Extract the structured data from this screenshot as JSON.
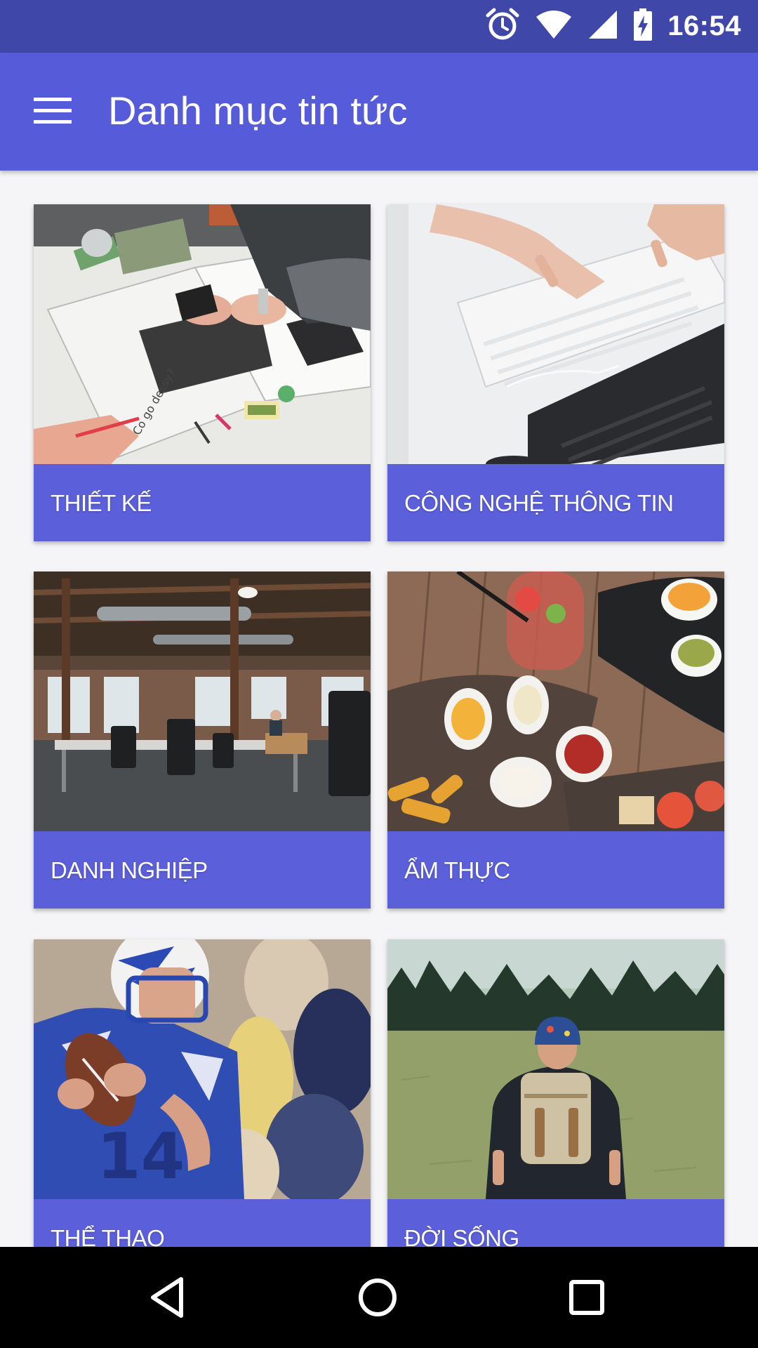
{
  "status_bar": {
    "time": "16:54",
    "icons": [
      "alarm-icon",
      "wifi-icon",
      "signal-icon",
      "battery-charging-icon"
    ],
    "background": "#3f48a8"
  },
  "app_bar": {
    "title": "Danh mục tin tức",
    "menu_icon": "hamburger-menu-icon",
    "background": "#565bda"
  },
  "categories": [
    {
      "label": "THIẾT KẾ",
      "image": "design-desk-photo"
    },
    {
      "label": "CÔNG NGHỆ THÔNG TIN",
      "image": "keyboard-typing-photo"
    },
    {
      "label": "DANH NGHIỆP",
      "image": "office-interior-photo"
    },
    {
      "label": "ẨM THỰC",
      "image": "food-table-photo"
    },
    {
      "label": "THỂ THAO",
      "image": "football-player-photo"
    },
    {
      "label": "ĐỜI SỐNG",
      "image": "hiker-field-photo"
    }
  ],
  "card_label_color": "#5b5fd9",
  "nav_bar": {
    "buttons": [
      "back-icon",
      "home-icon",
      "recents-icon"
    ]
  }
}
